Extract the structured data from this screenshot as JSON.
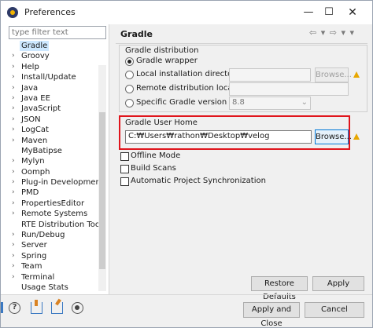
{
  "window": {
    "title": "Preferences",
    "minimize": "—",
    "maximize": "☐",
    "close": "✕"
  },
  "filter": {
    "placeholder": "type filter text"
  },
  "tree": [
    {
      "label": "Gradle",
      "expandable": false,
      "selected": true
    },
    {
      "label": "Groovy",
      "expandable": true
    },
    {
      "label": "Help",
      "expandable": true
    },
    {
      "label": "Install/Update",
      "expandable": true
    },
    {
      "label": "Java",
      "expandable": true
    },
    {
      "label": "Java EE",
      "expandable": true
    },
    {
      "label": "JavaScript",
      "expandable": true
    },
    {
      "label": "JSON",
      "expandable": true
    },
    {
      "label": "LogCat",
      "expandable": true
    },
    {
      "label": "Maven",
      "expandable": true
    },
    {
      "label": "MyBatipse",
      "expandable": false
    },
    {
      "label": "Mylyn",
      "expandable": true
    },
    {
      "label": "Oomph",
      "expandable": true
    },
    {
      "label": "Plug-in Development",
      "expandable": true
    },
    {
      "label": "PMD",
      "expandable": true
    },
    {
      "label": "PropertiesEditor",
      "expandable": true
    },
    {
      "label": "Remote Systems",
      "expandable": true
    },
    {
      "label": "RTE Distribution Tool",
      "expandable": false
    },
    {
      "label": "Run/Debug",
      "expandable": true
    },
    {
      "label": "Server",
      "expandable": true
    },
    {
      "label": "Spring",
      "expandable": true
    },
    {
      "label": "Team",
      "expandable": true
    },
    {
      "label": "Terminal",
      "expandable": true
    },
    {
      "label": "Usage Stats",
      "expandable": false
    }
  ],
  "page": {
    "title": "Gradle",
    "nav_arrows": "⇦ ▾ ⇨ ▾ ▾"
  },
  "distribution": {
    "legend": "Gradle distribution",
    "options": [
      {
        "label": "Gradle wrapper",
        "selected": true
      },
      {
        "label": "Local installation directory",
        "selected": false
      },
      {
        "label": "Remote distribution location",
        "selected": false
      },
      {
        "label": "Specific Gradle version",
        "selected": false
      }
    ],
    "browse_label": "Browse...",
    "version_value": "8.8"
  },
  "user_home": {
    "legend": "Gradle User Home",
    "value": "C:₩Users₩rathon₩Desktop₩velog",
    "browse_label": "Browse..."
  },
  "checkboxes": [
    {
      "label": "Offline Mode",
      "checked": false
    },
    {
      "label": "Build Scans",
      "checked": false
    },
    {
      "label": "Automatic Project Synchronization",
      "checked": false
    }
  ],
  "buttons": {
    "restore_defaults": "Restore Defaults",
    "apply": "Apply",
    "apply_and_close": "Apply and Close",
    "cancel": "Cancel"
  },
  "icons": [
    "help-icon",
    "import-icon",
    "export-icon",
    "record-icon"
  ],
  "colors": {
    "highlight": "#e0151c",
    "selection": "#cde8ff",
    "focus": "#0078d7",
    "warning": "#e8a700"
  }
}
